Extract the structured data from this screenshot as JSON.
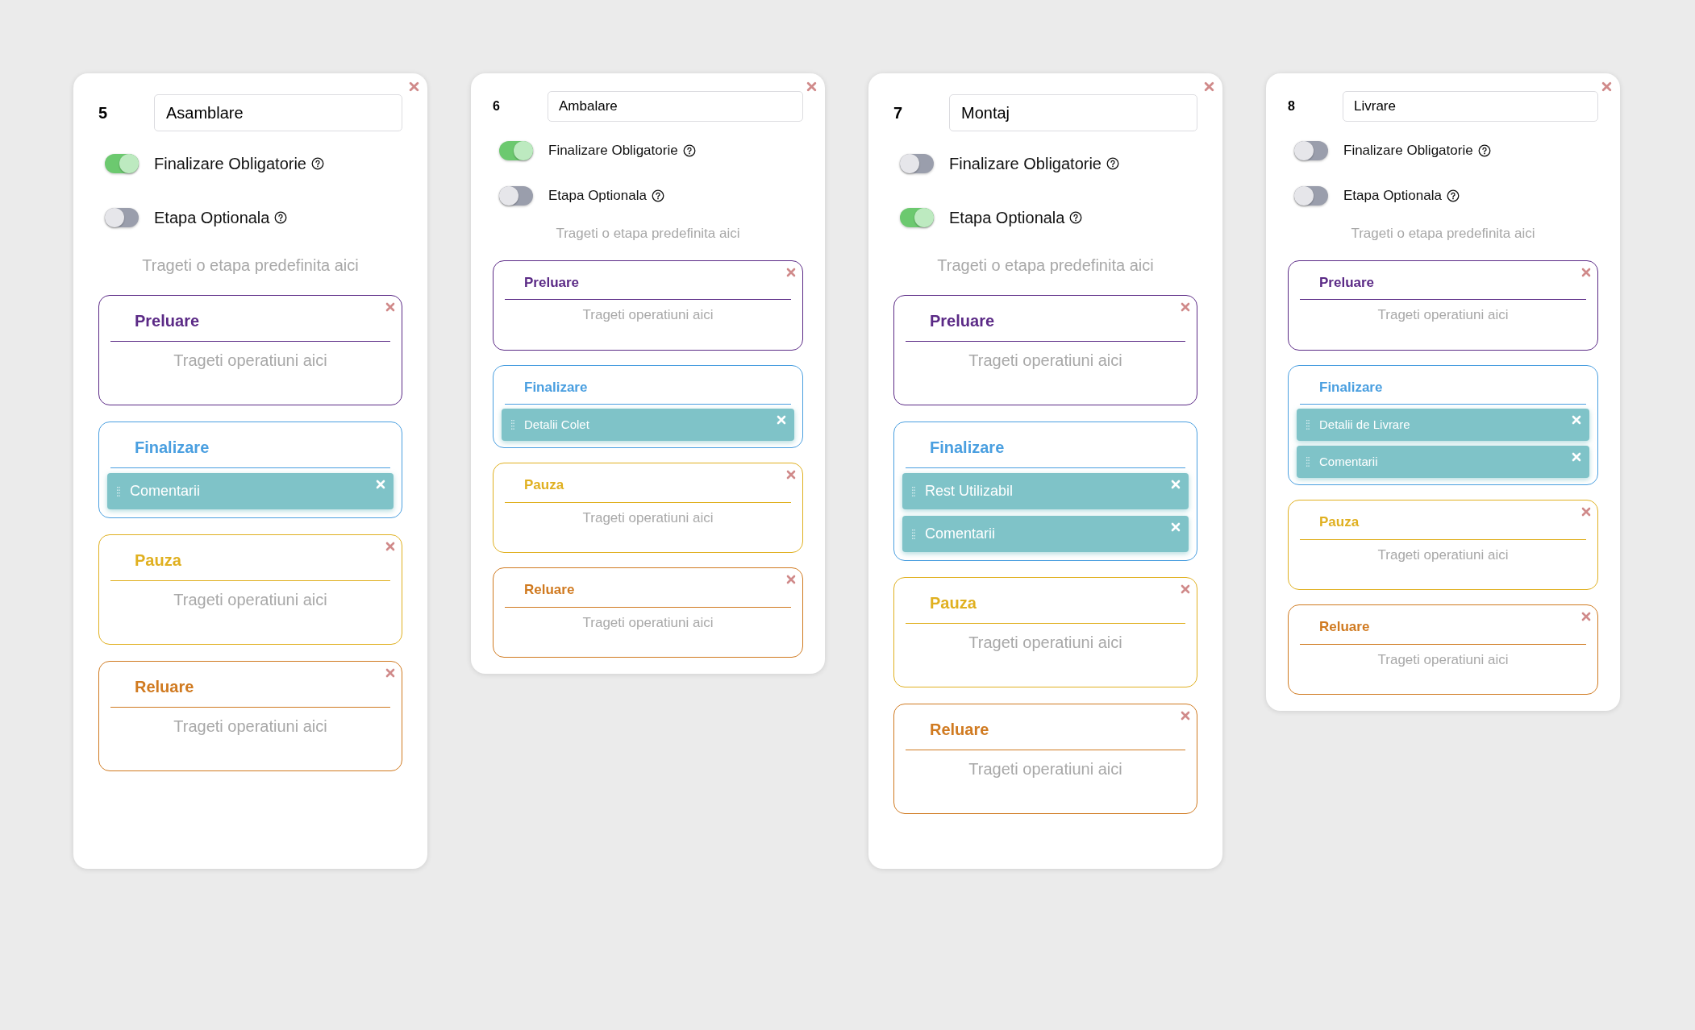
{
  "stages": [
    {
      "kind": "large",
      "number": "5",
      "name": "Asamblare",
      "toggles": [
        {
          "label": "Finalizare Obligatorie",
          "on": true
        },
        {
          "label": "Etapa Optionala",
          "on": false
        }
      ],
      "hint": "Trageti o etapa predefinita aici",
      "sections": [
        {
          "title": "Preluare",
          "color": "#5b2a86",
          "placeholder": "Trageti operatiuni aici"
        },
        {
          "title": "Finalizare",
          "color": "#4a9fe0",
          "items": [
            "Comentarii"
          ]
        },
        {
          "title": "Pauza",
          "color": "#e0b020",
          "placeholder": "Trageti operatiuni aici"
        },
        {
          "title": "Reluare",
          "color": "#d07a20",
          "placeholder": "Trageti operatiuni aici"
        }
      ]
    },
    {
      "kind": "compact",
      "number": "6",
      "name": "Ambalare",
      "toggles": [
        {
          "label": "Finalizare Obligatorie",
          "on": true
        },
        {
          "label": "Etapa Optionala",
          "on": false
        }
      ],
      "hint": "Trageti o etapa predefinita aici",
      "sections": [
        {
          "title": "Preluare",
          "color": "#5b2a86",
          "placeholder": "Trageti operatiuni aici"
        },
        {
          "title": "Finalizare",
          "color": "#4a9fe0",
          "items": [
            "Detalii Colet"
          ]
        },
        {
          "title": "Pauza",
          "color": "#e0b020",
          "placeholder": "Trageti operatiuni aici"
        },
        {
          "title": "Reluare",
          "color": "#d07a20",
          "placeholder": "Trageti operatiuni aici"
        }
      ]
    },
    {
      "kind": "large",
      "number": "7",
      "name": "Montaj",
      "toggles": [
        {
          "label": "Finalizare Obligatorie",
          "on": false
        },
        {
          "label": "Etapa Optionala",
          "on": true
        }
      ],
      "hint": "Trageti o etapa predefinita aici",
      "sections": [
        {
          "title": "Preluare",
          "color": "#5b2a86",
          "placeholder": "Trageti operatiuni aici"
        },
        {
          "title": "Finalizare",
          "color": "#4a9fe0",
          "items": [
            "Rest Utilizabil",
            "Comentarii"
          ]
        },
        {
          "title": "Pauza",
          "color": "#e0b020",
          "placeholder": "Trageti operatiuni aici"
        },
        {
          "title": "Reluare",
          "color": "#d07a20",
          "placeholder": "Trageti operatiuni aici"
        }
      ]
    },
    {
      "kind": "compact",
      "number": "8",
      "name": "Livrare",
      "toggles": [
        {
          "label": "Finalizare Obligatorie",
          "on": false
        },
        {
          "label": "Etapa Optionala",
          "on": false
        }
      ],
      "hint": "Trageti o etapa predefinita aici",
      "sections": [
        {
          "title": "Preluare",
          "color": "#5b2a86",
          "placeholder": "Trageti operatiuni aici"
        },
        {
          "title": "Finalizare",
          "color": "#4a9fe0",
          "items": [
            "Detalii de Livrare",
            "Comentarii"
          ]
        },
        {
          "title": "Pauza",
          "color": "#e0b020",
          "placeholder": "Trageti operatiuni aici"
        },
        {
          "title": "Reluare",
          "color": "#d07a20",
          "placeholder": "Trageti operatiuni aici"
        }
      ]
    }
  ]
}
